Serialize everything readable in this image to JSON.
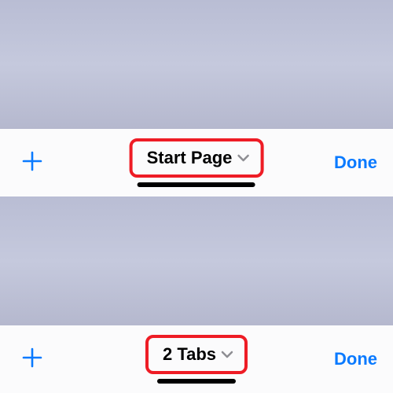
{
  "panels": [
    {
      "center_label": "Start Page",
      "done_label": "Done"
    },
    {
      "center_label": "2 Tabs",
      "done_label": "Done"
    }
  ],
  "colors": {
    "accent": "#0a7aff",
    "highlight": "#ee1c25"
  }
}
